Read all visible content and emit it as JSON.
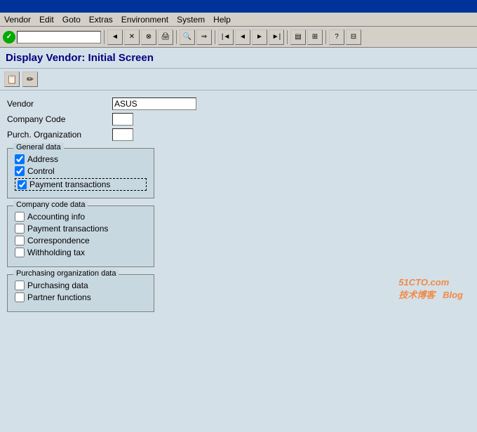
{
  "titleBar": {
    "text": ""
  },
  "menuBar": {
    "items": [
      "Vendor",
      "Edit",
      "Goto",
      "Extras",
      "Environment",
      "System",
      "Help"
    ]
  },
  "pageTitle": "Display Vendor:  Initial Screen",
  "formFields": {
    "vendorLabel": "Vendor",
    "vendorValue": "ASUS",
    "companyCodeLabel": "Company Code",
    "companyCodeValue": "",
    "purchOrgLabel": "Purch. Organization",
    "purchOrgValue": ""
  },
  "generalDataSection": {
    "title": "General data",
    "items": [
      {
        "label": "Address",
        "checked": true
      },
      {
        "label": "Control",
        "checked": true
      },
      {
        "label": "Payment transactions",
        "checked": true,
        "highlighted": true
      }
    ]
  },
  "companyCodeSection": {
    "title": "Company code data",
    "items": [
      {
        "label": "Accounting info",
        "checked": false
      },
      {
        "label": "Payment transactions",
        "checked": false
      },
      {
        "label": "Correspondence",
        "checked": false
      },
      {
        "label": "Withholding tax",
        "checked": false
      }
    ]
  },
  "purchasingSection": {
    "title": "Purchasing organization data",
    "items": [
      {
        "label": "Purchasing data",
        "checked": false
      },
      {
        "label": "Partner functions",
        "checked": false
      }
    ]
  },
  "watermark": {
    "line1": "51CTO.com",
    "line2": "技术博客",
    "suffix": "Blog"
  }
}
